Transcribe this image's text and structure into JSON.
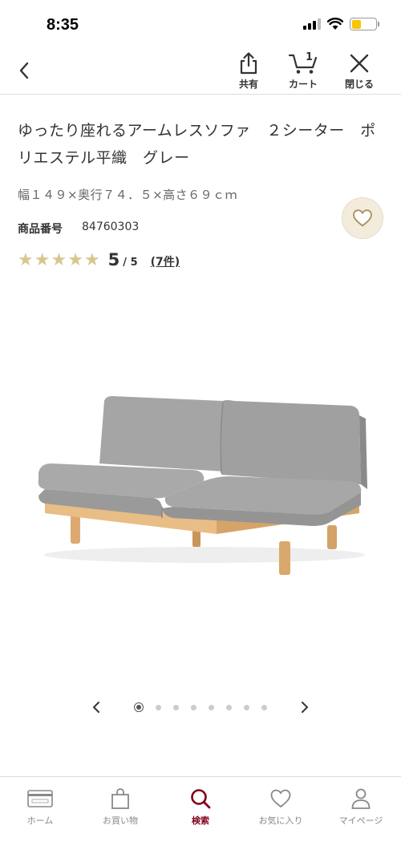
{
  "status_bar": {
    "time": "8:35"
  },
  "nav": {
    "share_label": "共有",
    "cart_label": "カート",
    "cart_count": "1",
    "close_label": "閉じる"
  },
  "product": {
    "title": "ゆったり座れるアームレスソファ　２シーター　ポリエステル平織　グレー",
    "size": "幅１４９×奥行７４．５×高さ６９ｃｍ",
    "code_label": "商品番号",
    "code": "84760303",
    "rating": {
      "score": "5",
      "max": "/ 5",
      "count": "(7件)",
      "stars": 5
    }
  },
  "carousel": {
    "total": 8,
    "active_index": 0
  },
  "tabs": [
    {
      "label": "ホーム",
      "icon": "card-icon"
    },
    {
      "label": "お買い物",
      "icon": "bag-icon"
    },
    {
      "label": "検索",
      "icon": "search-icon",
      "active": true
    },
    {
      "label": "お気に入り",
      "icon": "heart-icon"
    },
    {
      "label": "マイページ",
      "icon": "person-icon"
    }
  ],
  "colors": {
    "accent": "#7f0019",
    "star": "#d9c68f",
    "fav_bg": "#f3ecdd",
    "sofa_fabric": "#9b9b9b",
    "sofa_wood": "#e3b57c"
  }
}
